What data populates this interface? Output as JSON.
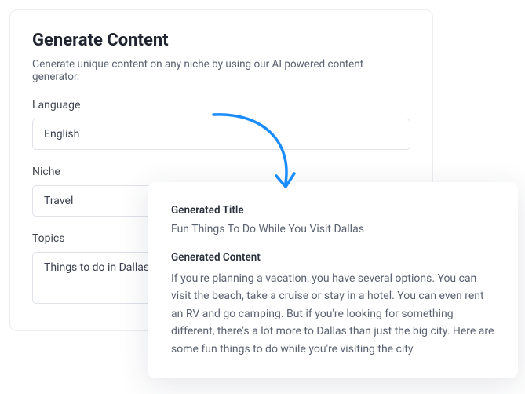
{
  "form": {
    "title": "Generate Content",
    "subtitle": "Generate unique content on any niche by using our AI powered content generator.",
    "language_label": "Language",
    "language_value": "English",
    "niche_label": "Niche",
    "niche_value": "Travel",
    "topics_label": "Topics",
    "topics_value": "Things to do in Dallas "
  },
  "result": {
    "title_label": "Generated Title",
    "title_value": "Fun Things To Do While You Visit Dallas",
    "content_label": "Generated Content",
    "content_value": "If you're planning a vacation, you have several options. You can visit the beach, take a cruise or stay in a hotel. You can even rent an RV and go camping. But if you're looking for something different, there's a lot more to Dallas than just the big city. Here are some fun things to do while you're visiting the city."
  },
  "colors": {
    "arrow": "#1a8cff"
  }
}
